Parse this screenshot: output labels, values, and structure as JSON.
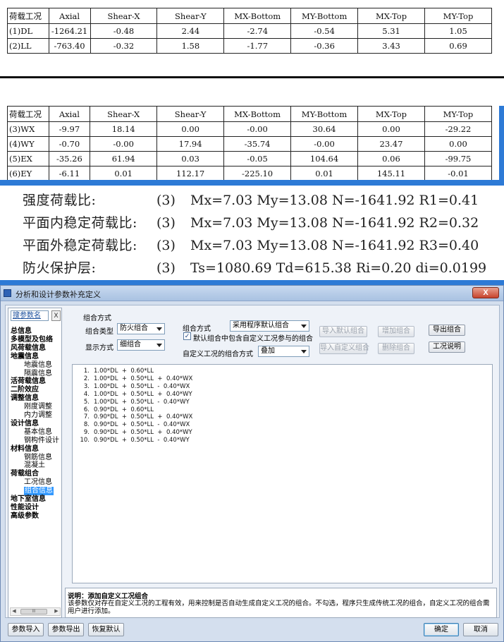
{
  "table1": {
    "headers": [
      "荷载工况",
      "Axial",
      "Shear-X",
      "Shear-Y",
      "MX-Bottom",
      "MY-Bottom",
      "MX-Top",
      "MY-Top"
    ],
    "rows": [
      [
        "(1)DL",
        "-1264.21",
        "-0.48",
        "2.44",
        "-2.74",
        "-0.54",
        "5.31",
        "1.05"
      ],
      [
        "(2)LL",
        "-763.40",
        "-0.32",
        "1.58",
        "-1.77",
        "-0.36",
        "3.43",
        "0.69"
      ]
    ]
  },
  "table2": {
    "headers": [
      "荷载工况",
      "Axial",
      "Shear-X",
      "Shear-Y",
      "MX-Bottom",
      "MY-Bottom",
      "MX-Top",
      "MY-Top"
    ],
    "rows": [
      [
        "(3)WX",
        "-9.97",
        "18.14",
        "0.00",
        "-0.00",
        "30.64",
        "0.00",
        "-29.22"
      ],
      [
        "(4)WY",
        "-0.70",
        "-0.00",
        "17.94",
        "-35.74",
        "-0.00",
        "23.47",
        "0.00"
      ],
      [
        "(5)EX",
        "-35.26",
        "61.94",
        "0.03",
        "-0.05",
        "104.64",
        "0.06",
        "-99.75"
      ],
      [
        "(6)EY",
        "-6.11",
        "0.01",
        "112.17",
        "-225.10",
        "0.01",
        "145.11",
        "-0.01"
      ]
    ]
  },
  "ratios": [
    {
      "label": "强度荷载比:",
      "case": "(3)",
      "values": "Mx=7.03 My=13.08 N=-1641.92 R1=0.41"
    },
    {
      "label": "平面内稳定荷载比:",
      "case": "(3)",
      "values": "Mx=7.03 My=13.08 N=-1641.92 R2=0.32"
    },
    {
      "label": "平面外稳定荷载比:",
      "case": "(3)",
      "values": "Mx=7.03 My=13.08 N=-1641.92 R3=0.40"
    },
    {
      "label": "防火保护层:",
      "case": "(3)",
      "values": "Ts=1080.69  Td=615.38  Ri=0.20  di=0.0199"
    }
  ],
  "dialog": {
    "title": "分析和设计参数补充定义",
    "close_label": "X",
    "search_label": "搜参数名",
    "search_clear": "X",
    "tree": [
      {
        "label": "总信息",
        "level": 0
      },
      {
        "label": "多模型及包络",
        "level": 0
      },
      {
        "label": "风荷载信息",
        "level": 0
      },
      {
        "label": "地震信息",
        "level": 0
      },
      {
        "label": "地震信息",
        "level": 1
      },
      {
        "label": "隔震信息",
        "level": 1
      },
      {
        "label": "活荷载信息",
        "level": 0
      },
      {
        "label": "二阶效应",
        "level": 0
      },
      {
        "label": "调整信息",
        "level": 0
      },
      {
        "label": "刚度调整",
        "level": 1
      },
      {
        "label": "内力调整",
        "level": 1
      },
      {
        "label": "设计信息",
        "level": 0
      },
      {
        "label": "基本信息",
        "level": 1
      },
      {
        "label": "钢构件设计",
        "level": 1
      },
      {
        "label": "材料信息",
        "level": 0
      },
      {
        "label": "钢筋信息",
        "level": 1
      },
      {
        "label": "混凝土",
        "level": 1
      },
      {
        "label": "荷载组合",
        "level": 0
      },
      {
        "label": "工况信息",
        "level": 1
      },
      {
        "label": "组合信息",
        "level": 1,
        "selected": true
      },
      {
        "label": "地下室信息",
        "level": 0
      },
      {
        "label": "性能设计",
        "level": 0
      },
      {
        "label": "高级参数",
        "level": 0
      }
    ],
    "scroll_thumb": "III",
    "group_label": "组合方式",
    "combo_type_label": "组合类型",
    "combo_type_value": "防火组合",
    "display_mode_label": "显示方式",
    "display_mode_value": "细组合",
    "combo_method_label": "组合方式",
    "combo_method_value": "采用程序默认组合",
    "default_include_label": "默认组合中包含自定义工况参与的组合",
    "default_include_checked": true,
    "custom_method_label": "自定义工况的组合方式",
    "custom_method_value": "叠加",
    "btn_import_default": "导入默认组合",
    "btn_add_combo": "增加组合",
    "btn_export_combo": "导出组合",
    "btn_import_custom": "导入自定义组合",
    "btn_delete_combo": "删除组合",
    "btn_case_desc": "工况说明",
    "combinations": [
      "1.00*DL  +  0.60*LL",
      "1.00*DL  +  0.50*LL  +  0.40*WX",
      "1.00*DL  +  0.50*LL  -  0.40*WX",
      "1.00*DL  +  0.50*LL  +  0.40*WY",
      "1.00*DL  +  0.50*LL  -  0.40*WY",
      "0.90*DL  +  0.60*LL",
      "0.90*DL  +  0.50*LL  +  0.40*WX",
      "0.90*DL  +  0.50*LL  -  0.40*WX",
      "0.90*DL  +  0.50*LL  +  0.40*WY",
      "0.90*DL  +  0.50*LL  -  0.40*WY"
    ],
    "desc_title": "说明：添加自定义工况组合",
    "desc_text": "该参数仅对存在自定义工况的工程有效，用来控制是否自动生成自定义工况的组合。不勾选，程序只生成传统工况的组合，自定义工况的组合需用户进行添加。",
    "footer": {
      "import_params": "参数导入",
      "export_params": "参数导出",
      "restore_default": "恢复默认",
      "ok": "确定",
      "cancel": "取消"
    }
  }
}
